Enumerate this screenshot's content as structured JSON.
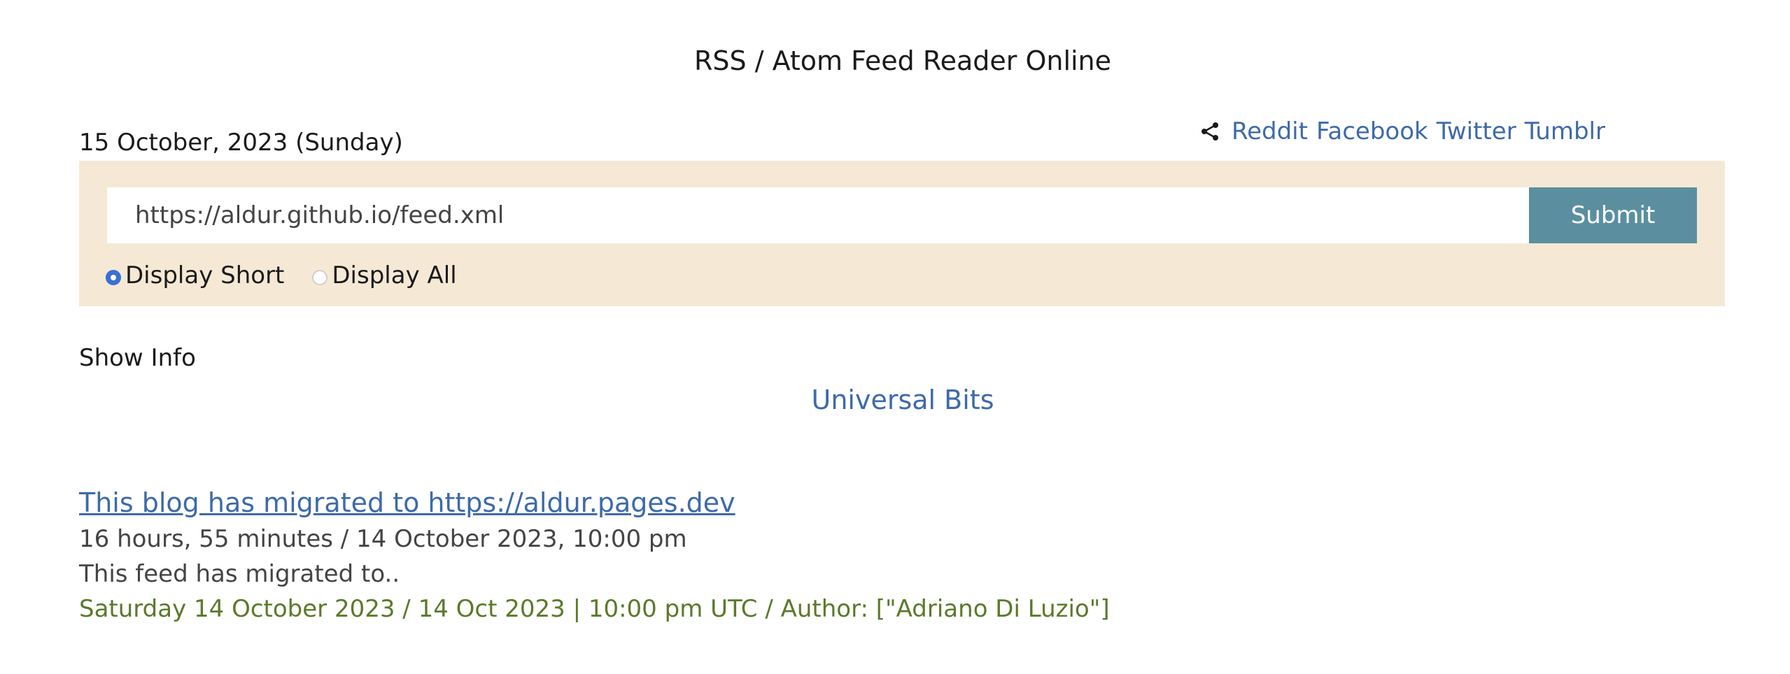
{
  "header": {
    "title": "RSS / Atom Feed Reader Online"
  },
  "date": "15 October, 2023 (Sunday)",
  "share": {
    "icon": "share-icon",
    "links": [
      "Reddit",
      "Facebook",
      "Twitter",
      "Tumblr"
    ]
  },
  "form": {
    "url_value": "https://aldur.github.io/feed.xml",
    "submit_label": "Submit",
    "options": [
      {
        "label": "Display Short",
        "checked": true
      },
      {
        "label": "Display All",
        "checked": false
      }
    ]
  },
  "show_info_label": "Show Info",
  "feed": {
    "title": "Universal Bits"
  },
  "entries": [
    {
      "title": "This blog has migrated to https://aldur.pages.dev",
      "time": "16 hours, 55 minutes / 14 October 2023, 10:00 pm",
      "description": "This feed has migrated to..",
      "meta": "Saturday 14 October 2023 / 14 Oct 2023 | 10:00 pm UTC / Author: [\"Adriano Di Luzio\"]"
    }
  ],
  "colors": {
    "link": "#3e6aa8",
    "panel_bg": "#f5e9d5",
    "submit_bg": "#5b8fa0",
    "meta_green": "#5a7a2a"
  }
}
